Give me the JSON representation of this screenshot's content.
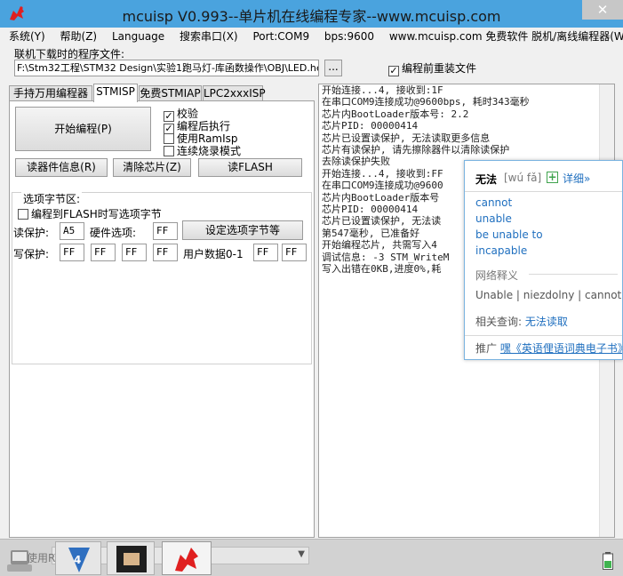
{
  "window": {
    "title": "mcuisp V0.993--单片机在线编程专家--www.mcuisp.com",
    "close_symbol": "✕"
  },
  "menu": [
    "系统(Y)",
    "帮助(Z)",
    "Language",
    "搜索串口(X)",
    "Port:COM9",
    "bps:9600",
    "www.mcuisp.com 免费软件 脱机/离线编程器(W)"
  ],
  "download": {
    "label": "联机下载时的程序文件:",
    "path": "F:\\Stm32工程\\STM32 Design\\实验1跑马灯-库函数操作\\OBJ\\LED.hex",
    "browse_label": "...",
    "reload_label": "编程前重装文件",
    "reload_checked": true
  },
  "tabs": [
    "手持万用编程器",
    "STMISP",
    "免费STMIAP",
    "LPC2xxxISP"
  ],
  "active_tab": "STMISP",
  "stmisp": {
    "start_button": "开始编程(P)",
    "checkboxes": [
      {
        "label": "校验",
        "checked": true
      },
      {
        "label": "编程后执行",
        "checked": true
      },
      {
        "label": "使用RamIsp",
        "checked": false
      },
      {
        "label": "连续烧录模式",
        "checked": false
      }
    ],
    "read_info_button": "读器件信息(R)",
    "erase_button": "清除芯片(Z)",
    "read_flash_button": "读FLASH",
    "options": {
      "title": "选项字节区:",
      "write_option_label": "编程到FLASH时写选项字节",
      "write_option_checked": false,
      "read_protect_label": "读保护:",
      "read_protect_value": "A5",
      "hw_option_label": "硬件选项:",
      "hw_option_value": "FF",
      "set_option_button": "设定选项字节等",
      "write_protect_label": "写保护:",
      "write_protect_values": [
        "FF",
        "FF",
        "FF",
        "FF"
      ],
      "user_data_label": "用户数据0-1",
      "user_data_values": [
        "FF",
        "FF"
      ]
    }
  },
  "log": [
    "开始连接...4, 接收到:1F",
    "在串口COM9连接成功@9600bps, 耗时343毫秒",
    "芯片内BootLoader版本号: 2.2",
    "芯片PID: 00000414",
    "芯片已设置读保护, 无法读取更多信息",
    "芯片有读保护, 请先擦除器件以清除读保护",
    "去除读保护失败",
    "开始连接...4, 接收到:FF",
    "在串口COM9连接成功@9600",
    "芯片内BootLoader版本号",
    "芯片PID: 00000414",
    "芯片已设置读保护, 无法读",
    "第547毫秒, 已准备好",
    "开始编程芯片, 共需写入4",
    "调试信息: -3 STM_WriteM",
    "写入出错在0KB,进度0%,耗"
  ],
  "dict": {
    "word": "无法",
    "pinyin": "[wú fǎ]",
    "detail_label": "详细»",
    "definitions": [
      "cannot",
      "unable",
      "be unable to",
      "incapable"
    ],
    "net_section": "网络释义",
    "net_definitions": "Unable | niezdolny | cannot",
    "related_label": "相关查询:",
    "related_link": "无法读取",
    "promo_label": "推广",
    "promo_link": "嘿《英语俚语词典电子书》"
  },
  "taskbar": {
    "status_text": "使用RTS",
    "status_suffix": "R"
  },
  "colors": {
    "titlebar": "#4aa3de",
    "accent_link": "#1f6fbf",
    "app_icon": "#e02020"
  }
}
